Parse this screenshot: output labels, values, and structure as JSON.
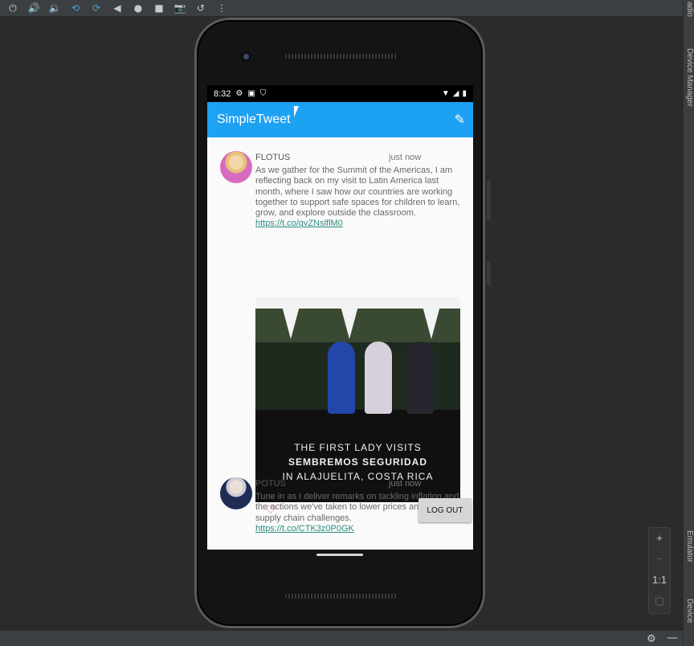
{
  "toolbar": {
    "icons": [
      "power-icon",
      "volume-up-icon",
      "volume-down-icon",
      "rotate-left-icon",
      "rotate-right-icon",
      "back-icon",
      "home-icon",
      "overview-icon",
      "camera-icon",
      "replay-icon",
      "more-icon"
    ]
  },
  "side_panel": {
    "top_label": "adio",
    "device_manager": "Device Manager",
    "emulator": "Emulator",
    "device": "Device"
  },
  "zoom_controls": {
    "plus": "+",
    "minus": "−",
    "one_to_one": "1:1"
  },
  "status_bar": {
    "time": "8:32"
  },
  "app_bar": {
    "title": "SimpleTweet"
  },
  "tweets": [
    {
      "user": "FLOTUS",
      "time": "just now",
      "text": "As we gather for the Summit of the Americas, I am reflecting back on my visit to Latin America last month, where I saw how our countries are working together to support safe spaces for children to learn, grow, and explore outside the classroom.",
      "link": "https://t.co/gvZNslflM0",
      "media_caption": [
        "THE FIRST LADY VISITS",
        "SEMBREMOS SEGURIDAD",
        "IN ALAJUELITA, COSTA RICA"
      ]
    },
    {
      "user": "POTUS",
      "time": "just now",
      "text": "Tune in as I deliver remarks on tackling inflation and the actions we've taken to lower prices and address supply chain challenges.",
      "link": "https://t.co/CTK3z0P0GK"
    }
  ],
  "buttons": {
    "logout": "LOG OUT"
  },
  "colors": {
    "app_bar": "#1da1f2",
    "link": "#2c8c7f",
    "heart": "#e53935"
  }
}
